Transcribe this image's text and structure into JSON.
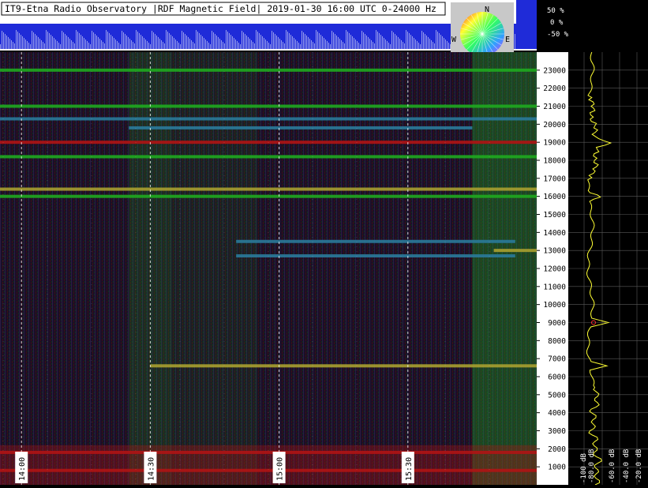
{
  "header": {
    "title": "IT9-Etna Radio Observatory |RDF Magnetic Field| 2019-01-30 16:00 UTC 0-24000 Hz"
  },
  "phase_scale": {
    "labels": [
      "50 %",
      "0 %",
      "-50 %"
    ]
  },
  "compass": {
    "labels": {
      "n": "N",
      "s": "S",
      "e": "E",
      "w": "W"
    }
  },
  "colors": {
    "background": "#000000",
    "header_bg": "#ffffff",
    "strip_blue": "#1f2bd8",
    "grid_dash": "#ffffff",
    "axis_text": "#000000",
    "spectrum_trace": "#ffff33",
    "spectrum_peak": "#ff3030",
    "band_green": "#1faa1f",
    "band_red": "#b01414",
    "band_teal": "#2a7a9a",
    "band_yellow": "#a8a030"
  },
  "chart_data": {
    "type": "heatmap",
    "title": "IT9-Etna Radio Observatory |RDF Magnetic Field| 2019-01-30 16:00 UTC 0-24000 Hz",
    "x": {
      "unit": "UTC",
      "range": [
        "13:55",
        "16:00"
      ],
      "ticks": [
        "14:00",
        "14:30",
        "15:00",
        "15:30"
      ]
    },
    "y": {
      "unit": "Hz",
      "range": [
        0,
        24000
      ],
      "ticks": [
        1000,
        2000,
        3000,
        4000,
        5000,
        6000,
        7000,
        8000,
        9000,
        10000,
        11000,
        12000,
        13000,
        14000,
        15000,
        16000,
        17000,
        18000,
        19000,
        20000,
        21000,
        22000,
        23000
      ]
    },
    "bands": [
      {
        "freq": 23000,
        "color": "band_green",
        "start": "13:55",
        "end": "16:00"
      },
      {
        "freq": 21000,
        "color": "band_green",
        "start": "13:55",
        "end": "16:00"
      },
      {
        "freq": 20300,
        "color": "band_teal",
        "start": "13:55",
        "end": "16:00"
      },
      {
        "freq": 19800,
        "color": "band_teal",
        "start": "14:25",
        "end": "15:45"
      },
      {
        "freq": 19000,
        "color": "band_red",
        "start": "13:55",
        "end": "16:00"
      },
      {
        "freq": 18200,
        "color": "band_green",
        "start": "13:55",
        "end": "16:00"
      },
      {
        "freq": 16400,
        "color": "band_yellow",
        "start": "13:55",
        "end": "16:00"
      },
      {
        "freq": 16000,
        "color": "band_green",
        "start": "13:55",
        "end": "16:00"
      },
      {
        "freq": 13500,
        "color": "band_teal",
        "start": "14:50",
        "end": "15:55"
      },
      {
        "freq": 13000,
        "color": "band_yellow",
        "start": "15:50",
        "end": "16:00"
      },
      {
        "freq": 12700,
        "color": "band_teal",
        "start": "14:50",
        "end": "15:55"
      },
      {
        "freq": 6600,
        "color": "band_yellow",
        "start": "14:30",
        "end": "16:00"
      },
      {
        "freq": 1800,
        "color": "band_red",
        "start": "13:55",
        "end": "16:00"
      },
      {
        "freq": 800,
        "color": "band_red",
        "start": "13:55",
        "end": "16:00"
      }
    ],
    "spectrum": {
      "x_unit": "dB",
      "x_ticks": [
        "-100 dB",
        "-80.0 dB",
        "-60.0 dB",
        "-40.0 dB",
        "-20.0 dB"
      ],
      "peaks_hz": [
        16000,
        19000,
        6600,
        9000
      ]
    }
  }
}
